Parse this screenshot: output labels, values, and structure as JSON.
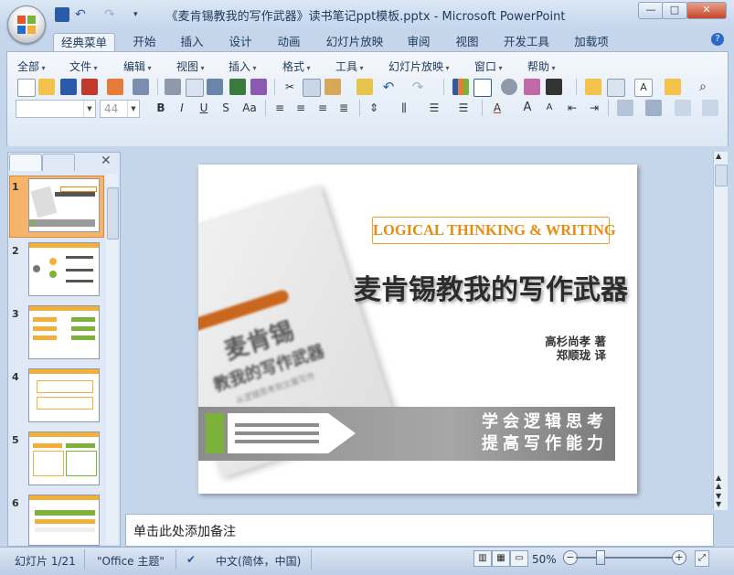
{
  "window": {
    "title": "《麦肯锡教我的写作武器》读书笔记ppt模板.pptx - Microsoft PowerPoint",
    "minimize": "—",
    "maximize": "□",
    "close": "✕"
  },
  "ribbon_tabs": [
    "经典菜单",
    "开始",
    "插入",
    "设计",
    "动画",
    "幻灯片放映",
    "审阅",
    "视图",
    "开发工具",
    "加载项"
  ],
  "classic_menu": [
    "全部",
    "文件",
    "编辑",
    "视图",
    "插入",
    "格式",
    "工具",
    "幻灯片放映",
    "窗口",
    "帮助"
  ],
  "format_bar": {
    "font_name": "",
    "font_size": "44",
    "bold": "B",
    "italic": "I",
    "underline": "U",
    "strike": "S",
    "case": "Aa",
    "grow_font": "A",
    "shrink_font": "A",
    "text_box_icon_label": "A"
  },
  "slides_pane": {
    "slide_numbers": [
      "1",
      "2",
      "3",
      "4",
      "5",
      "6"
    ],
    "selected": "1"
  },
  "slide": {
    "logic_label": "LOGICAL THINKING & WRITING",
    "main_title": "麦肯锡教我的写作武器",
    "author_line1": "高杉尚孝   著",
    "author_line2": "郑顺珑   译",
    "banner_line1": "学会逻辑思考",
    "banner_line2": "提高写作能力",
    "book_title_1": "麦肯锡",
    "book_title_2": "教我的写作武器",
    "book_subtitle": "从逻辑思考到文案写作"
  },
  "notes_placeholder": "单击此处添加备注",
  "status_bar": {
    "slide_count": "幻灯片 1/21",
    "theme": "\"Office 主题\"",
    "language": "中文(简体，中国)",
    "zoom": "50%",
    "zoom_out": "−",
    "zoom_in": "+"
  },
  "colors": {
    "accent_orange": "#e98b12",
    "banner_green": "#7cb23a",
    "ribbon_blue": "#c5d6ea"
  }
}
